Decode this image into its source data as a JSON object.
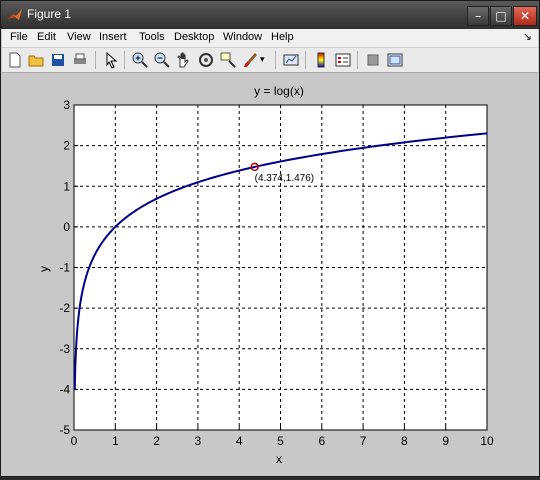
{
  "window": {
    "title": "Figure 1"
  },
  "menu": {
    "items": [
      "File",
      "Edit",
      "View",
      "Insert",
      "Tools",
      "Desktop",
      "Window",
      "Help"
    ]
  },
  "toolbar_icons": [
    "new-figure-icon",
    "open-icon",
    "save-icon",
    "print-icon",
    "select-arrow-icon",
    "zoom-in-icon",
    "zoom-out-icon",
    "pan-hand-icon",
    "rotate-3d-icon",
    "data-cursor-icon",
    "brush-icon",
    "brush-dropdown-icon",
    "link-plot-icon",
    "colorbar-icon",
    "legend-icon",
    "hide-plot-tools-icon",
    "show-plot-tools-icon"
  ],
  "chart_data": {
    "type": "line",
    "title": "y = log(x)",
    "xlabel": "x",
    "ylabel": "y",
    "xlim": [
      0,
      10
    ],
    "ylim": [
      -5,
      3
    ],
    "xticks": [
      "0",
      "1",
      "2",
      "3",
      "4",
      "5",
      "6",
      "7",
      "8",
      "9",
      "10"
    ],
    "yticks": [
      "3",
      "2",
      "1",
      "0",
      "-1",
      "-2",
      "-3",
      "-4",
      "-5"
    ],
    "grid": true,
    "series": [
      {
        "function": "log(x)",
        "x_range": [
          0.018,
          10
        ],
        "color": "#00008b"
      }
    ],
    "datatip": {
      "x": 4.374,
      "y": 1.476,
      "label": "(4.374,1.476)"
    }
  }
}
